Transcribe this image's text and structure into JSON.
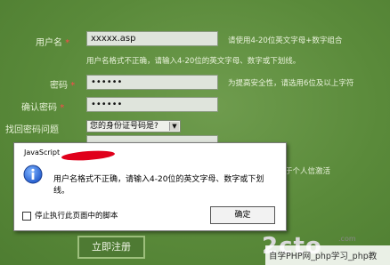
{
  "form": {
    "username_label": "用户名",
    "required_mark": "*",
    "username_value": "xxxxx.asp",
    "username_hint": "请使用4-20位英文字母+数字组合",
    "username_error": "用户名格式不正确，请输入4-20位的英文字母、数字或下划线。",
    "password_label": "密码",
    "password_value": "••••••",
    "password_hint": "为提高安全性，请选用6位及以上字符",
    "confirm_label": "确认密码",
    "confirm_value": "••••••",
    "question_label": "找回密码问题",
    "question_value": "您的身份证号码是?",
    "partial_hint": "于个人信激活",
    "register_label": "立即注册"
  },
  "dialog": {
    "title": "JavaScript",
    "message": "用户名格式不正确，请输入4-20位的英文字母、数字或下划线。",
    "checkbox_label": "停止执行此页面中的脚本",
    "ok_label": "确定"
  },
  "watermark": {
    "logo": "2cto",
    "url": ".com",
    "text": "自学PHP网_php学习_php教"
  },
  "colors": {
    "background": "#5a8a3a",
    "required": "#ff4a4a",
    "redact": "#e0001b"
  }
}
